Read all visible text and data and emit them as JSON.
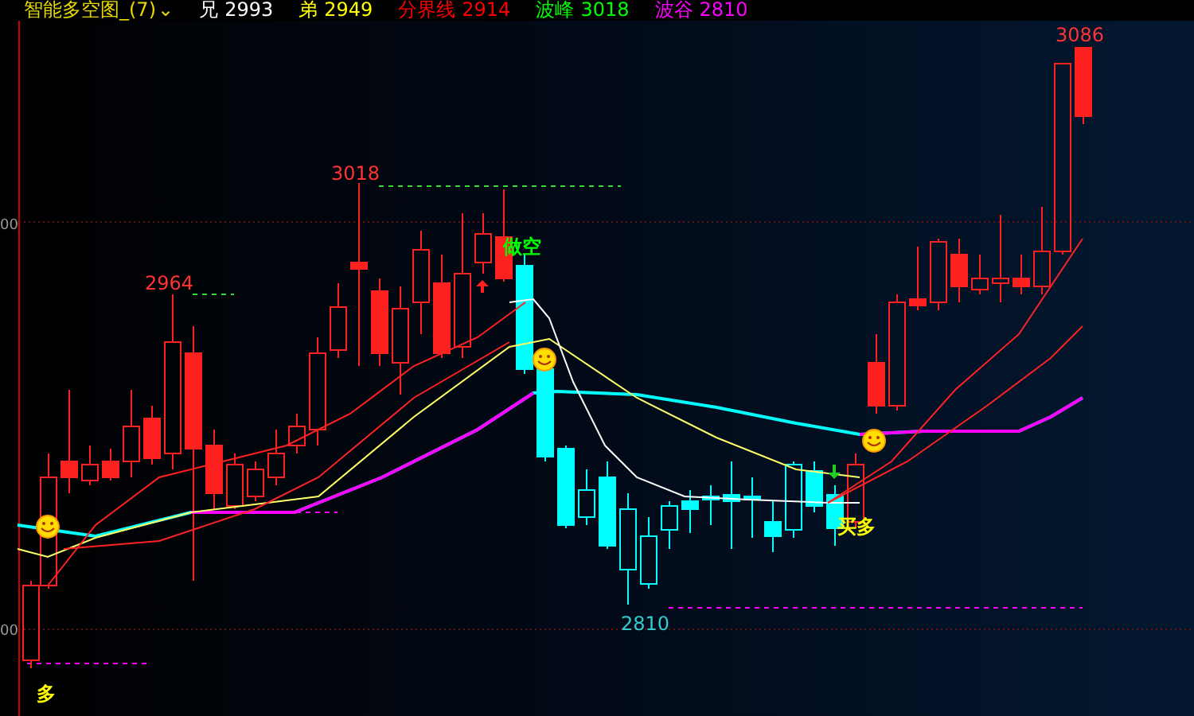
{
  "indicator": {
    "title": "智能多空图_(7)",
    "dropdown_icon": "⌄"
  },
  "legend": [
    {
      "label": "兄",
      "value": "2993",
      "color": "#ffffff"
    },
    {
      "label": "弟",
      "value": "2949",
      "color": "#ffff00"
    },
    {
      "label": "分界线",
      "value": "2914",
      "color": "#ff0000"
    },
    {
      "label": "波峰",
      "value": "3018",
      "color": "#00ff00"
    },
    {
      "label": "波谷",
      "value": "2810",
      "color": "#ff00ff"
    }
  ],
  "axis_labels": [
    "00",
    "00"
  ],
  "chart_labels": [
    {
      "kind": "price",
      "text": "3086",
      "color": "#ff3333"
    },
    {
      "kind": "price",
      "text": "3018",
      "color": "#ff3333"
    },
    {
      "kind": "price",
      "text": "2964",
      "color": "#ff3333"
    },
    {
      "kind": "price",
      "text": "2810",
      "color": "#33cccc"
    },
    {
      "kind": "signal",
      "text": "做空",
      "color": "#00ff00"
    },
    {
      "kind": "signal",
      "text": "买多",
      "color": "#ffff00"
    },
    {
      "kind": "signal",
      "text": "多",
      "color": "#ffff00"
    }
  ]
}
